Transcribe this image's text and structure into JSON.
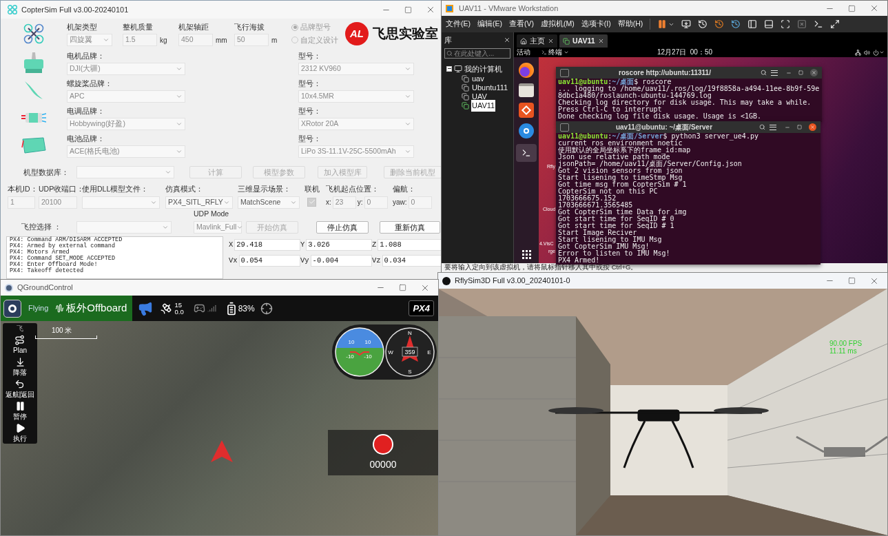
{
  "coptersim": {
    "title": "CopterSim Full v3.00-20240101",
    "frame_fields": [
      {
        "label": "机架类型",
        "value": "四旋翼",
        "kind": "select"
      },
      {
        "label": "整机质量",
        "value": "1.5",
        "unit": "kg",
        "kind": "input"
      },
      {
        "label": "机架轴距",
        "value": "450",
        "unit": "mm",
        "kind": "input"
      },
      {
        "label": "飞行海拔",
        "value": "50",
        "unit": "m",
        "kind": "input"
      }
    ],
    "design_modes": [
      {
        "label": "品牌型号",
        "selected": true
      },
      {
        "label": "自定义设计",
        "selected": false
      }
    ],
    "lab_logo": {
      "mark": "AL",
      "name": "飞思实验室"
    },
    "components": [
      {
        "kind": "motor",
        "brand_label": "电机品牌：",
        "brand": "DJI(大疆)",
        "model_label": "型号：",
        "model": "2312 KV960"
      },
      {
        "kind": "propeller",
        "brand_label": "螺旋桨品牌：",
        "brand": "APC",
        "model_label": "型号：",
        "model": "10x4.5MR"
      },
      {
        "kind": "esc",
        "brand_label": "电调品牌：",
        "brand": "Hobbywing(好盈)",
        "model_label": "型号：",
        "model": "XRotor 20A"
      },
      {
        "kind": "battery",
        "brand_label": "电池品牌：",
        "brand": "ACE(格氏电池)",
        "model_label": "型号：",
        "model": "LiPo 3S-11.1V-25C-5500mAh"
      }
    ],
    "model_database": {
      "label": "机型数据库：",
      "buttons": [
        {
          "label": "计算",
          "disabled": true
        },
        {
          "label": "模型参数",
          "disabled": true
        },
        {
          "label": "加入模型库",
          "disabled": true
        },
        {
          "label": "删除当前机型",
          "disabled": true
        }
      ]
    },
    "sim_settings": [
      {
        "label": "本机ID：",
        "kind": "input",
        "value": "1"
      },
      {
        "label": "UDP收端口：",
        "kind": "input",
        "value": "20100"
      },
      {
        "label": "使用DLL模型文件：",
        "kind": "select"
      },
      {
        "label": "仿真模式：",
        "kind": "select",
        "value": "PX4_SITL_RFLY"
      },
      {
        "label": "三维显示场景：",
        "kind": "select",
        "value": "MatchScene"
      },
      {
        "label": "联机",
        "kind": "checkbox",
        "checked": true
      },
      {
        "label": "飞机起点位置：",
        "kind": "coords",
        "fields": [
          {
            "label": "x:",
            "value": "23"
          },
          {
            "label": "y:",
            "value": "0"
          }
        ]
      },
      {
        "label": "偏航：",
        "kind": "coords",
        "fields": [
          {
            "label": "yaw:",
            "value": "0"
          }
        ]
      }
    ],
    "controller": {
      "label": "飞控选择 ：",
      "udp_mode_label": "UDP Mode",
      "udp_mode": "Mavlink_Full",
      "buttons": [
        {
          "label": "开始仿真",
          "disabled": true
        },
        {
          "label": "停止仿真",
          "disabled": false
        },
        {
          "label": "重新仿真",
          "disabled": false
        }
      ]
    },
    "log_lines": [
      "PX4: Command ARM/DISARM ACCEPTED",
      "PX4: Armed by external command",
      "PX4: Motors Armed",
      "PX4: Command SET_MODE ACCEPTED",
      "PX4: Enter Offboard Mode!",
      "PX4: Takeoff detected"
    ],
    "readouts": [
      [
        {
          "label": "X",
          "value": "29.418"
        },
        {
          "label": "Y",
          "value": "3.026"
        },
        {
          "label": "Z",
          "value": "1.088"
        }
      ],
      [
        {
          "label": "Vx",
          "value": "0.054"
        },
        {
          "label": "Vy",
          "value": "-0.004"
        },
        {
          "label": "Vz",
          "value": "0.034"
        }
      ]
    ]
  },
  "vmware": {
    "title": "UAV11 - VMware Workstation",
    "menu": [
      "文件(E)",
      "编辑(E)",
      "查看(V)",
      "虚拟机(M)",
      "选项卡(I)",
      "帮助(H)"
    ],
    "library": {
      "title": "库",
      "search_placeholder": "在此处键入...",
      "tree": [
        {
          "label": "我的计算机",
          "expanded": true,
          "children": [
            {
              "label": "uav",
              "selected": false
            },
            {
              "label": "Ubuntu111",
              "selected": false
            },
            {
              "label": "UAV",
              "selected": false
            },
            {
              "label": "UAV11",
              "selected": true
            }
          ]
        }
      ]
    },
    "tabs": [
      {
        "label": "主页",
        "selected": false
      },
      {
        "label": "UAV11",
        "selected": true
      }
    ],
    "guest": {
      "activities": "活动",
      "app_menu": "终端",
      "clock": "12月27日  00：50",
      "desktop_labels": [
        "Rfly",
        "Cloud",
        "4.VisC",
        "rge"
      ],
      "terminals": [
        {
          "title": "roscore http://ubuntu:11311/",
          "lines": [
            {
              "kind": "prompt",
              "user": "uav11@ubuntu",
              "sep": ":",
              "path": "~/桌面",
              "command": "$ roscore"
            },
            {
              "kind": "text",
              "text": "... logging to /home/uav11/.ros/log/19f8858a-a494-11ee-8b9f-59e8dbc1a480/roslaunch-ubuntu-144769.log"
            },
            {
              "kind": "text",
              "text": "Checking log directory for disk usage. This may take a while."
            },
            {
              "kind": "text",
              "text": "Press Ctrl-C to interrupt"
            },
            {
              "kind": "text",
              "text": "Done checking log file disk usage. Usage is <1GB."
            }
          ]
        },
        {
          "title": "uav11@ubuntu: ~/桌面/Server",
          "lines": [
            {
              "kind": "prompt",
              "user": "uav11@ubuntu",
              "sep": ":",
              "path": "~/桌面/Server",
              "command": "$ python3 server_ue4.py"
            },
            {
              "kind": "text",
              "text": "current ros environment noetic"
            },
            {
              "kind": "text",
              "text": "使用默认的全局坐标系下的frame_id:map"
            },
            {
              "kind": "text",
              "text": "Json use relative path mode"
            },
            {
              "kind": "text",
              "text": "jsonPath= /home/uav11/桌面/Server/Config.json"
            },
            {
              "kind": "text",
              "text": "Got 2 vision sensors from json"
            },
            {
              "kind": "text",
              "text": "Start lisening to timeStmp Msg"
            },
            {
              "kind": "text",
              "text": "Got time msg from CopterSim # 1"
            },
            {
              "kind": "text",
              "text": "CopterSim not on this PC"
            },
            {
              "kind": "text",
              "text": "1703666675.152"
            },
            {
              "kind": "text",
              "text": "1703666671.3565485"
            },
            {
              "kind": "text",
              "text": "Got CopterSim time Data for img"
            },
            {
              "kind": "text",
              "text": "Got start time for SeqID # 0"
            },
            {
              "kind": "text",
              "text": "Got start time for SeqID # 1"
            },
            {
              "kind": "text",
              "text": "Start Image Reciver"
            },
            {
              "kind": "text",
              "text": "Start lisening to IMU Msg"
            },
            {
              "kind": "text",
              "text": "Got CopterSim IMU Msg!"
            },
            {
              "kind": "text",
              "text": "Error to listen to IMU Msg!"
            },
            {
              "kind": "text",
              "text": "PX4 Armed!"
            }
          ]
        }
      ]
    },
    "status": "要将输入定向到该虚拟机，请将鼠标指针移入其中或按 Ctrl+G。"
  },
  "qgc": {
    "title": "QGroundControl",
    "flight_state": "Flying",
    "flight_mode": "板外Offboard",
    "satellites": {
      "count": "15",
      "hdop": "0.0"
    },
    "battery": "83%",
    "brand": "PX4",
    "tools_header": "飞",
    "tools": [
      {
        "label": "Plan",
        "kind": "plan"
      },
      {
        "label": "降落",
        "kind": "land"
      },
      {
        "label": "返航|返回",
        "kind": "rtl"
      },
      {
        "label": "暂停",
        "kind": "pause"
      },
      {
        "label": "执行",
        "kind": "play"
      }
    ],
    "map_scale": "100 米",
    "attitude_labels": [
      "10",
      "10",
      "-10",
      "-10"
    ],
    "compass": {
      "heading": "359",
      "north": "N",
      "east": "E",
      "south": "S",
      "west": "W"
    },
    "video_counter": "00000"
  },
  "rflysim": {
    "title": "RflySim3D Full v3.00_20240101-0",
    "fps": "90.00 FPS",
    "frame_time": "11.11 ms"
  }
}
